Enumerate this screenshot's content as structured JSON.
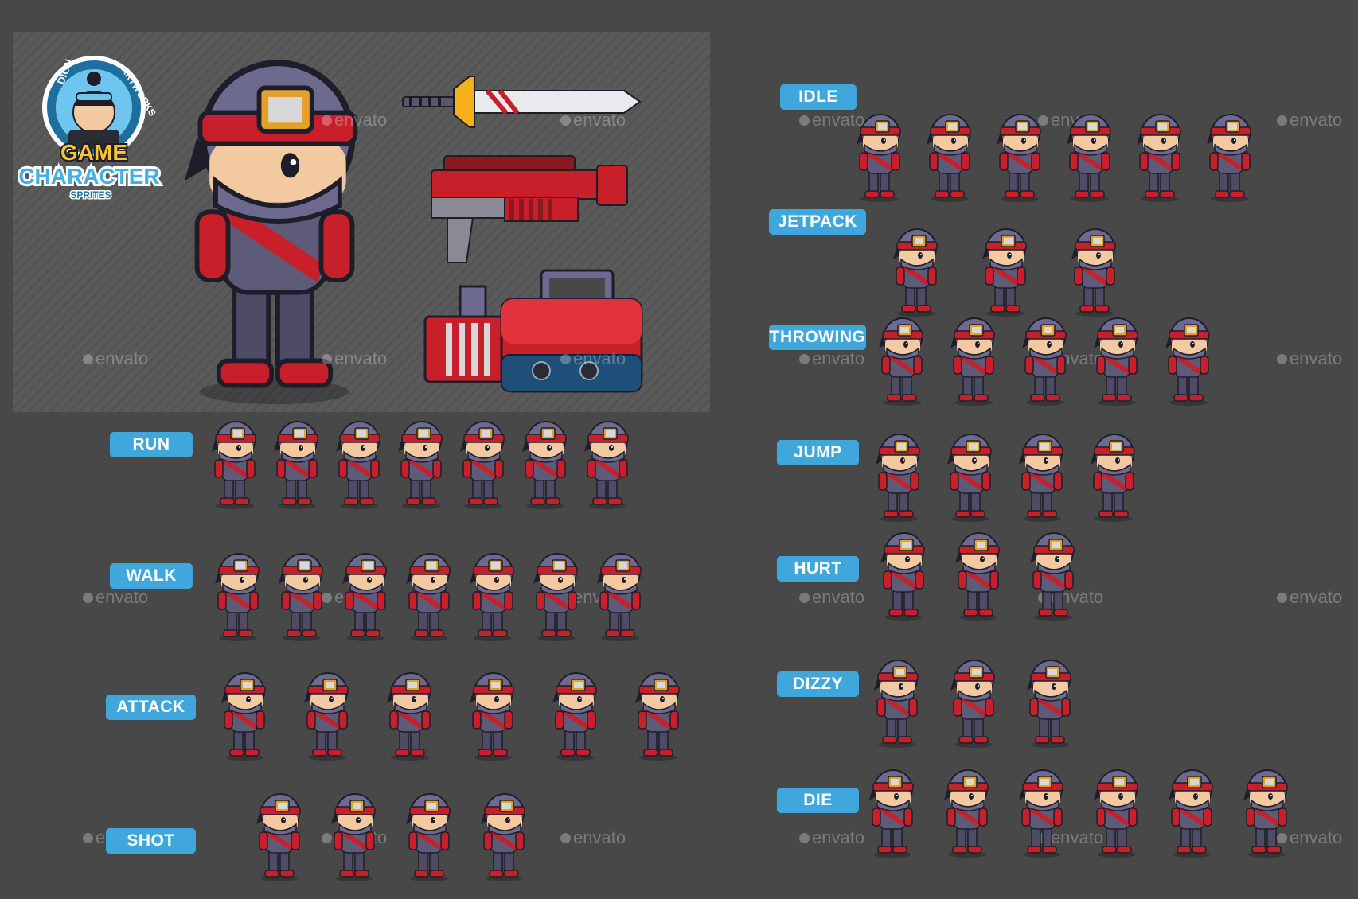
{
  "logo": {
    "text_top": "DION",
    "text_arc": "ARTWORKS",
    "title_line1": "GAME",
    "title_line2": "CHARACTER",
    "title_line3": "SPRITES"
  },
  "watermark": "envato",
  "animations": {
    "left": [
      {
        "label": "RUN",
        "frames": 7
      },
      {
        "label": "WALK",
        "frames": 7
      },
      {
        "label": "ATTACK",
        "frames": 6
      },
      {
        "label": "SHOT",
        "frames": 4
      }
    ],
    "right": [
      {
        "label": "IDLE",
        "frames": 6
      },
      {
        "label": "JETPACK",
        "frames": 3
      },
      {
        "label": "THROWING",
        "frames": 5
      },
      {
        "label": "JUMP",
        "frames": 4
      },
      {
        "label": "HURT",
        "frames": 3
      },
      {
        "label": "DIZZY",
        "frames": 3
      },
      {
        "label": "DIE",
        "frames": 6
      }
    ]
  },
  "colors": {
    "background": "#484848",
    "label_bg": "#3fa7dc",
    "hat": "#6c6a8e",
    "headband": "#c8202b",
    "body": "#5d5b78"
  }
}
